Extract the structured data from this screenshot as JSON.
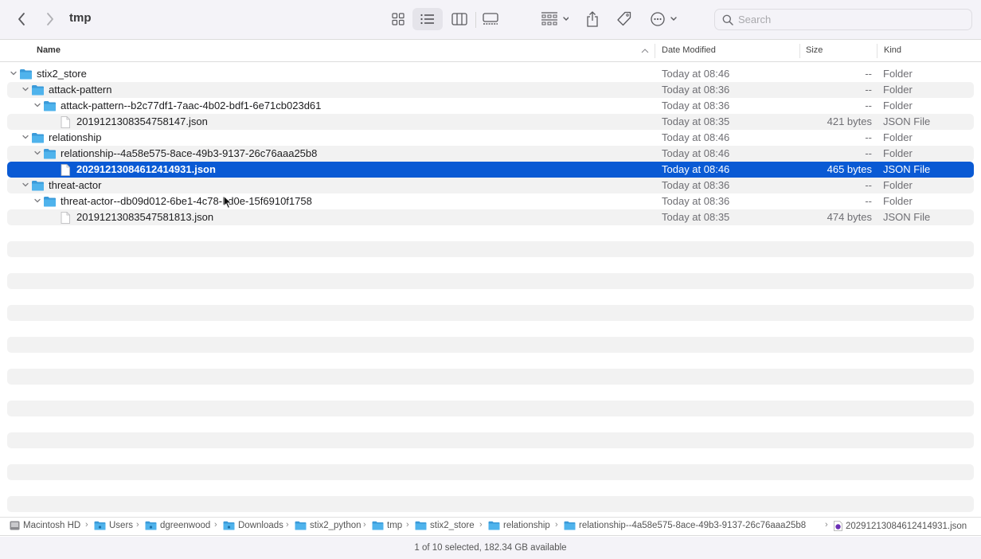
{
  "window": {
    "title": "tmp"
  },
  "toolbar": {
    "back_icon": "chevron-left-icon",
    "forward_icon": "chevron-right-icon",
    "views": [
      {
        "name": "icon-view",
        "icon": "grid-icon",
        "active": false
      },
      {
        "name": "list-view",
        "icon": "list-icon",
        "active": true
      },
      {
        "name": "column-view",
        "icon": "columns-icon",
        "active": false
      },
      {
        "name": "gallery-view",
        "icon": "gallery-icon",
        "active": false
      }
    ],
    "group_icon": "group-by-icon",
    "share_icon": "share-icon",
    "tag_icon": "tag-icon",
    "more_icon": "ellipsis-circle-icon",
    "search": {
      "placeholder": "Search",
      "value": ""
    }
  },
  "columns": {
    "name": "Name",
    "date": "Date Modified",
    "size": "Size",
    "kind": "Kind"
  },
  "rows": [
    {
      "name": "stix2_store",
      "date": "Today at 08:46",
      "size": "--",
      "kind": "Folder",
      "type": "folder",
      "level": 0,
      "expanded": true,
      "selected": false
    },
    {
      "name": "attack-pattern",
      "date": "Today at 08:36",
      "size": "--",
      "kind": "Folder",
      "type": "folder",
      "level": 1,
      "expanded": true,
      "selected": false
    },
    {
      "name": "attack-pattern--b2c77df1-7aac-4b02-bdf1-6e71cb023d61",
      "date": "Today at 08:36",
      "size": "--",
      "kind": "Folder",
      "type": "folder",
      "level": 2,
      "expanded": true,
      "selected": false
    },
    {
      "name": "2019121308354758147.json",
      "date": "Today at 08:35",
      "size": "421 bytes",
      "kind": "JSON File",
      "type": "file",
      "level": 3,
      "expanded": false,
      "selected": false
    },
    {
      "name": "relationship",
      "date": "Today at 08:46",
      "size": "--",
      "kind": "Folder",
      "type": "folder",
      "level": 1,
      "expanded": true,
      "selected": false
    },
    {
      "name": "relationship--4a58e575-8ace-49b3-9137-26c76aaa25b8",
      "date": "Today at 08:46",
      "size": "--",
      "kind": "Folder",
      "type": "folder",
      "level": 2,
      "expanded": true,
      "selected": false
    },
    {
      "name": "20291213084612414931.json",
      "date": "Today at 08:46",
      "size": "465 bytes",
      "kind": "JSON File",
      "type": "file",
      "level": 3,
      "expanded": false,
      "selected": true
    },
    {
      "name": "threat-actor",
      "date": "Today at 08:36",
      "size": "--",
      "kind": "Folder",
      "type": "folder",
      "level": 1,
      "expanded": true,
      "selected": false
    },
    {
      "name": "threat-actor--db09d012-6be1-4c78-bd0e-15f6910f1758",
      "date": "Today at 08:36",
      "size": "--",
      "kind": "Folder",
      "type": "folder",
      "level": 2,
      "expanded": true,
      "selected": false
    },
    {
      "name": "20191213083547581813.json",
      "date": "Today at 08:35",
      "size": "474 bytes",
      "kind": "JSON File",
      "type": "file",
      "level": 3,
      "expanded": false,
      "selected": false
    }
  ],
  "pathbar": [
    {
      "label": "Macintosh HD",
      "icon": "hard-drive-icon"
    },
    {
      "label": "Users",
      "icon": "users-folder-icon"
    },
    {
      "label": "dgreenwood",
      "icon": "home-folder-icon"
    },
    {
      "label": "Downloads",
      "icon": "downloads-folder-icon"
    },
    {
      "label": "stix2_python",
      "icon": "folder-icon"
    },
    {
      "label": "tmp",
      "icon": "folder-icon"
    },
    {
      "label": "stix2_store",
      "icon": "folder-icon"
    },
    {
      "label": "relationship",
      "icon": "folder-icon"
    },
    {
      "label": "relationship--4a58e575-8ace-49b3-9137-26c76aaa25b8",
      "icon": "folder-icon"
    },
    {
      "label": "20291213084612414931.json",
      "icon": "json-file-icon"
    }
  ],
  "status": "1 of 10 selected, 182.34 GB available",
  "colors": {
    "selection": "#0a5ad4",
    "folder": "#4fb3ec",
    "toolbar_bg": "#f4f3f8"
  }
}
